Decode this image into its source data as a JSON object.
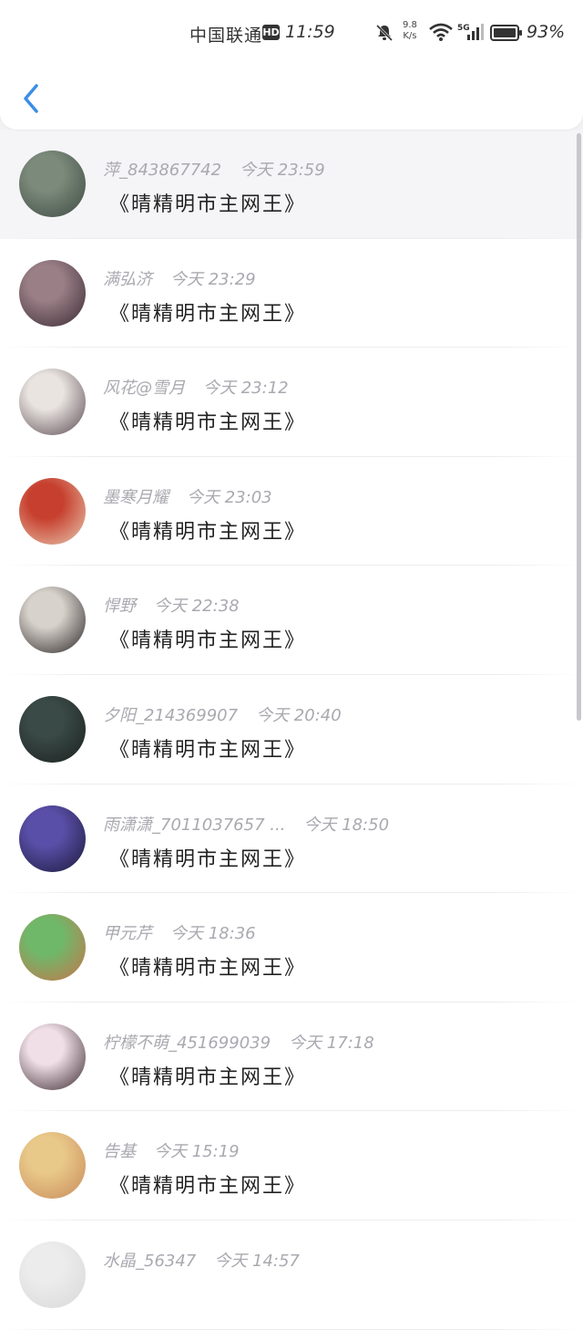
{
  "status_bar": {
    "carrier": "中国联通",
    "hd": "HD",
    "time": "11:59",
    "net_speed_value": "9.8",
    "net_speed_unit": "K/s",
    "signal_label": "5G",
    "battery": "93%"
  },
  "header": {
    "back_icon": "chevron-left-icon",
    "accent_color": "#3a8ee6"
  },
  "comments": [
    {
      "name": "萍_843867742",
      "time": "今天 23:59",
      "message": "《晴精明市主网王》",
      "avatar_colors": [
        "#7b8a7a",
        "#3e4a44"
      ]
    },
    {
      "name": "满弘济",
      "time": "今天 23:29",
      "message": "《晴精明市主网王》",
      "avatar_colors": [
        "#9a7f86",
        "#3a2a34"
      ]
    },
    {
      "name": "风花@雪月",
      "time": "今天 23:12",
      "message": "《晴精明市主网王》",
      "avatar_colors": [
        "#e9e4e0",
        "#5a4a52"
      ]
    },
    {
      "name": "墨寒月耀",
      "time": "今天 23:03",
      "message": "《晴精明市主网王》",
      "avatar_colors": [
        "#c7402f",
        "#e8c9b0"
      ]
    },
    {
      "name": "悍野",
      "time": "今天 22:38",
      "message": "《晴精明市主网王》",
      "avatar_colors": [
        "#d8d2cc",
        "#2a2626"
      ]
    },
    {
      "name": "夕阳_214369907",
      "time": "今天 20:40",
      "message": "《晴精明市主网王》",
      "avatar_colors": [
        "#3a4a46",
        "#1b2120"
      ]
    },
    {
      "name": "雨潇潇_7011037657 ...",
      "time": "今天 18:50",
      "message": "《晴精明市主网王》",
      "avatar_colors": [
        "#5a4fa8",
        "#1a1a3a"
      ]
    },
    {
      "name": "甲元芹",
      "time": "今天 18:36",
      "message": "《晴精明市主网王》",
      "avatar_colors": [
        "#6fb86a",
        "#c9734a"
      ]
    },
    {
      "name": "柠檬不萌_451699039",
      "time": "今天 17:18",
      "message": "《晴精明市主网王》",
      "avatar_colors": [
        "#f0dfe6",
        "#3a2a30"
      ]
    },
    {
      "name": "告基",
      "time": "今天 15:19",
      "message": "《晴精明市主网王》",
      "avatar_colors": [
        "#e9c98a",
        "#c88a5a"
      ]
    },
    {
      "name": "水晶_56347",
      "time": "今天 14:57",
      "message": "",
      "avatar_colors": [
        "#ececec",
        "#d8d8d8"
      ]
    }
  ]
}
